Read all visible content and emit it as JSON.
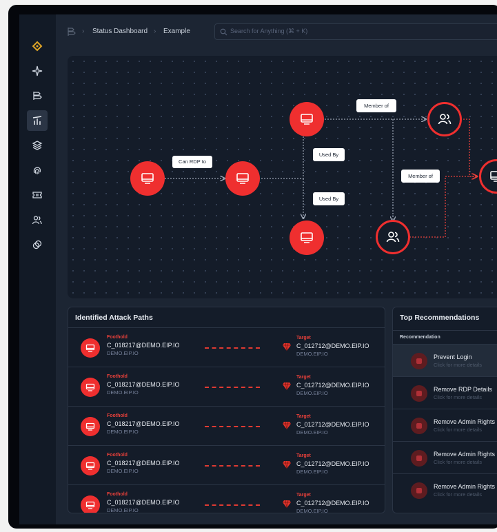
{
  "breadcrumb": {
    "first": "Status Dashboard",
    "second": "Example"
  },
  "search": {
    "placeholder": "Search for Anything (⌘ + K)"
  },
  "sidebar": {
    "items": [
      "logo-icon",
      "sparkle-icon",
      "flag-icon",
      "chart-icon",
      "layers-icon",
      "fingerprint-icon",
      "ticket-icon",
      "users-icon",
      "link-icon"
    ],
    "active": "chart-icon"
  },
  "graph": {
    "edges": {
      "rdp": "Can RDP to",
      "member1": "Member of",
      "member2": "Member of",
      "used1": "Used By",
      "used2": "Used By"
    }
  },
  "attack_paths": {
    "title": "Identified Attack Paths",
    "foothold_label": "Foothold",
    "target_label": "Target",
    "rows": [
      {
        "source": "C_018217@DEMO.EIP.IO",
        "source_domain": "DEMO.EIP.IO",
        "target": "C_012712@DEMO.EIP.IO",
        "target_domain": "DEMO.EIP.IO"
      },
      {
        "source": "C_018217@DEMO.EIP.IO",
        "source_domain": "DEMO.EIP.IO",
        "target": "C_012712@DEMO.EIP.IO",
        "target_domain": "DEMO.EIP.IO"
      },
      {
        "source": "C_018217@DEMO.EIP.IO",
        "source_domain": "DEMO.EIP.IO",
        "target": "C_012712@DEMO.EIP.IO",
        "target_domain": "DEMO.EIP.IO"
      },
      {
        "source": "C_018217@DEMO.EIP.IO",
        "source_domain": "DEMO.EIP.IO",
        "target": "C_012712@DEMO.EIP.IO",
        "target_domain": "DEMO.EIP.IO"
      },
      {
        "source": "C_018217@DEMO.EIP.IO",
        "source_domain": "DEMO.EIP.IO",
        "target": "C_012712@DEMO.EIP.IO",
        "target_domain": "DEMO.EIP.IO"
      }
    ]
  },
  "recommendations": {
    "title": "Top Recommendations",
    "column": "Recommendation",
    "rows": [
      {
        "title": "Prevent Login",
        "sub": "Click for more details",
        "selected": true
      },
      {
        "title": "Remove RDP Details",
        "sub": "Click for more details",
        "selected": false
      },
      {
        "title": "Remove Admin Rights",
        "sub": "Click for more details",
        "selected": false
      },
      {
        "title": "Remove Admin Rights",
        "sub": "Click for more details",
        "selected": false
      },
      {
        "title": "Remove Admin Rights",
        "sub": "Click for more details",
        "selected": false
      }
    ]
  },
  "colors": {
    "accent_red": "#ef2f2f",
    "logo_gold": "#e0a526",
    "panel_bg": "#141c29",
    "page_bg": "#1c2533"
  }
}
